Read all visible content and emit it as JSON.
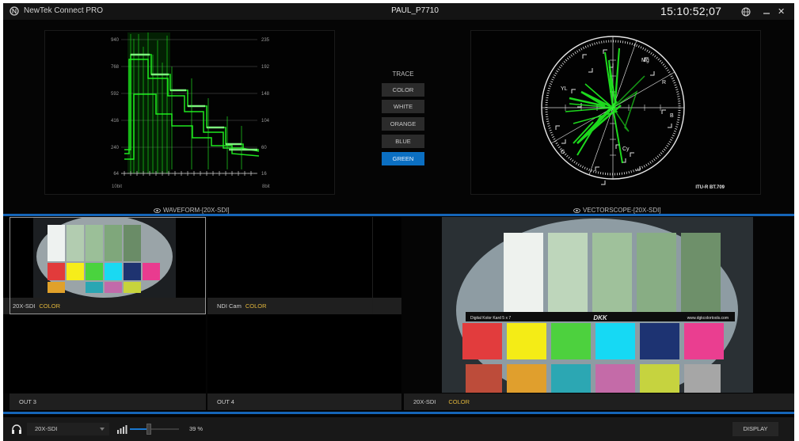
{
  "app": {
    "title": "NewTek Connect PRO",
    "host": "PAUL_P7710",
    "timecode": "15:10:52;07"
  },
  "waveform": {
    "caption": "WAVEFORM-[20X-SDI]",
    "left_ticks": [
      "940",
      "768",
      "592",
      "416",
      "240",
      "64"
    ],
    "right_ticks": [
      "235",
      "192",
      "148",
      "104",
      "60",
      "16"
    ],
    "left_unit": "10bit",
    "right_unit": "8bit"
  },
  "vectorscope": {
    "caption": "VECTORSCOPE-[20X-SDI]",
    "targets": [
      "YL",
      "Mg",
      "R",
      "B",
      "Cy",
      "G"
    ],
    "standard": "ITU-R BT.709"
  },
  "trace": {
    "label": "TRACE",
    "options": [
      "COLOR",
      "WHITE",
      "ORANGE",
      "BLUE",
      "GREEN"
    ],
    "selected": "GREEN"
  },
  "monitors": [
    {
      "source": "20X-SDI",
      "tag": "COLOR"
    },
    {
      "source": "NDI Cam",
      "tag": "COLOR"
    },
    {
      "source": "OUT 3",
      "tag": ""
    },
    {
      "source": "OUT 4",
      "tag": ""
    }
  ],
  "program": {
    "source": "20X-SDI",
    "tag": "COLOR",
    "chart_title": "DKK",
    "chart_left_text": "Digital Kolor Kard 5 x 7",
    "chart_right_text": "www.dgkcolortools.com"
  },
  "audio": {
    "source": "20X-SDI",
    "volume_percent": 39,
    "volume_text": "39 %"
  },
  "footer": {
    "display_label": "DISPLAY"
  },
  "colors": {
    "accent_blue": "#1565b8",
    "trace_green": "#22ff22",
    "tag_yellow": "#e0b53b"
  }
}
